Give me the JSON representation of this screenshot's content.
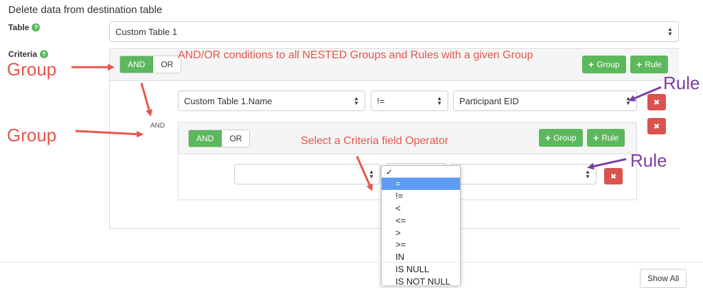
{
  "page": {
    "title": "Delete data from destination table",
    "table_label": "Table",
    "criteria_label": "Criteria",
    "help_glyph": "?"
  },
  "table_select": {
    "value": "Custom Table 1"
  },
  "outer_group": {
    "and_label": "AND",
    "or_label": "OR",
    "add_group_label": "Group",
    "add_rule_label": "Rule",
    "connector_label": "AND",
    "rule": {
      "field": "Custom Table 1.Name",
      "operator": "!=",
      "value": "Participant EID",
      "delete_glyph": "✖"
    },
    "delete_glyph": "✖"
  },
  "inner_group": {
    "and_label": "AND",
    "or_label": "OR",
    "add_group_label": "Group",
    "add_rule_label": "Rule",
    "rule": {
      "field": "",
      "operator": "",
      "value": "",
      "delete_glyph": "✖"
    }
  },
  "operator_dropdown": {
    "check": "✓",
    "options": [
      "=",
      "!=",
      "<",
      "<=",
      ">",
      ">=",
      "IN",
      "IS NULL",
      "IS NOT NULL"
    ],
    "selected_index": 0
  },
  "annotations": {
    "group_top": "Group",
    "group_mid": "Group",
    "andor_note": "AND/OR conditions to all NESTED Groups and Rules with a given Group",
    "operator_note": "Select a Criteria field Operator",
    "rule_top": "Rule",
    "rule_bottom": "Rule"
  },
  "footer": {
    "show_all": "Show All"
  },
  "colors": {
    "annotation_red": "#e5564a",
    "annotation_purple": "#7b3fa0",
    "green": "#5cb85c",
    "danger": "#d9534f",
    "highlight": "#5e9bf5"
  }
}
